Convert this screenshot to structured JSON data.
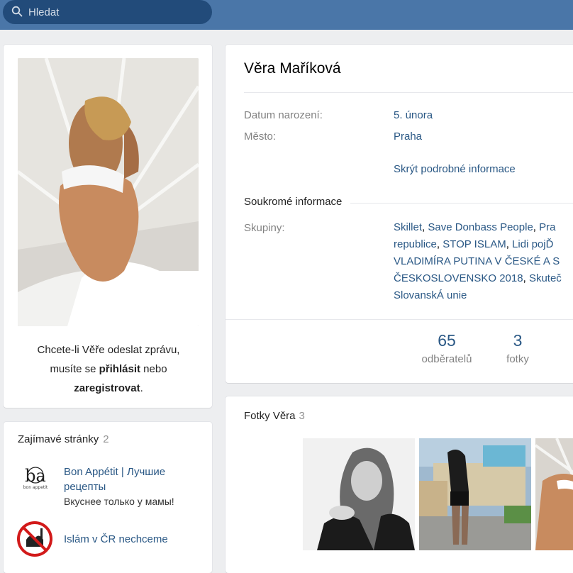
{
  "search": {
    "placeholder": "Hledat",
    "icon": "search-icon"
  },
  "profile": {
    "name": "Věra Maříková",
    "info": [
      {
        "label": "Datum narození:",
        "value": "5. února"
      },
      {
        "label": "Město:",
        "value": "Praha"
      }
    ],
    "toggle_details": "Skrýt podrobné informace",
    "private_section": "Soukromé informace",
    "groups_label": "Skupiny:",
    "groups_lines": [
      [
        {
          "t": "Skillet",
          "link": true
        },
        {
          "t": ", ",
          "link": false
        },
        {
          "t": "Save Donbass People",
          "link": true
        },
        {
          "t": ", ",
          "link": false
        },
        {
          "t": "Pra",
          "link": true
        }
      ],
      [
        {
          "t": "republice",
          "link": true
        },
        {
          "t": ", ",
          "link": false
        },
        {
          "t": "STOP ISLAM",
          "link": true
        },
        {
          "t": ", ",
          "link": false
        },
        {
          "t": "Lidi pojĎ",
          "link": true
        }
      ],
      [
        {
          "t": "VLADIMÍRA PUTINA V ČESKÉ A S",
          "link": true
        }
      ],
      [
        {
          "t": "ČESKOSLOVENSKO 2018",
          "link": true
        },
        {
          "t": ", ",
          "link": false
        },
        {
          "t": "Skuteč",
          "link": true
        }
      ],
      [
        {
          "t": "SlovanskÁ unie",
          "link": true
        }
      ]
    ],
    "stats": [
      {
        "num": "65",
        "label": "odběratelů"
      },
      {
        "num": "3",
        "label": "fotky"
      }
    ]
  },
  "sidebar": {
    "message_note": {
      "line1": "Chcete-li Věře odeslat zprávu,",
      "line2_pre": "musíte se ",
      "login": "přihlásit",
      "line2_post": " nebo",
      "register": "zaregistrovat",
      "end": "."
    },
    "pages": {
      "title": "Zajímavé stránky",
      "count": "2",
      "items": [
        {
          "name": "Bon Appétit | Лучшие рецепты",
          "sub": "Вкуснее только у мамы!",
          "logo_text": "bon appetit"
        },
        {
          "name": "Islám v ČR nechceme",
          "sub": ""
        }
      ]
    }
  },
  "photos": {
    "title": "Fotky Věra",
    "count": "3"
  },
  "colors": {
    "header": "#4a76a8",
    "search_bg": "#224b7a",
    "link": "#2a5885",
    "page_bg": "#edeef0"
  }
}
